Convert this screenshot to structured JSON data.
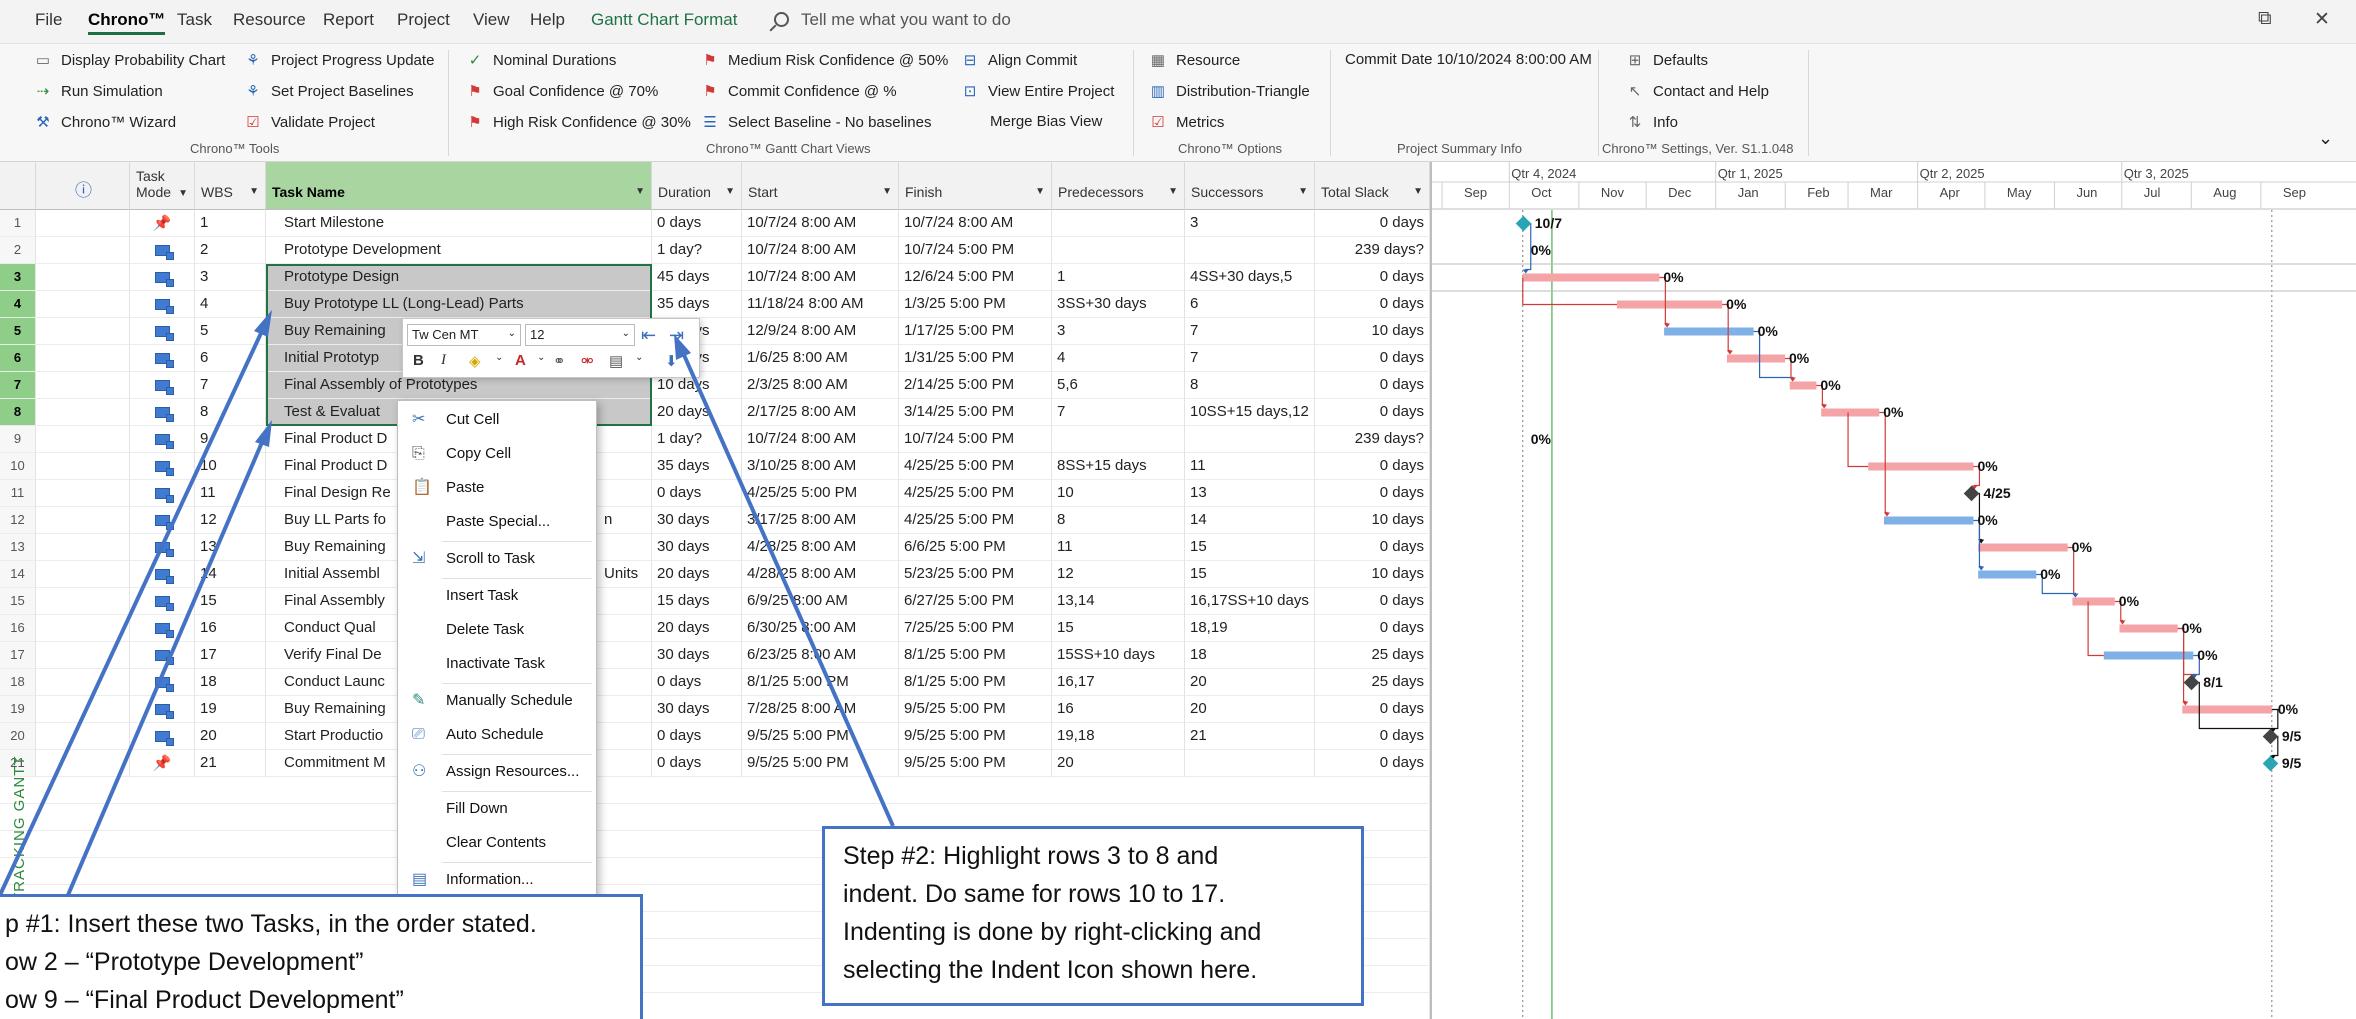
{
  "menu": {
    "items": [
      "File",
      "Chrono™",
      "Task",
      "Resource",
      "Report",
      "Project",
      "View",
      "Help",
      "Gantt Chart Format"
    ],
    "tell_me": "Tell me what you want to do",
    "restore": "⧉",
    "close": "✕"
  },
  "ribbon": {
    "tools": {
      "display_probability_chart": "Display Probability Chart",
      "run_simulation": "Run Simulation",
      "chrono_wizard": "Chrono™ Wizard",
      "project_progress_update": "Project Progress Update",
      "set_project_baselines": "Set Project Baselines",
      "validate_project": "Validate Project",
      "group_label": "Chrono™ Tools"
    },
    "views": {
      "nominal_durations": "Nominal Durations",
      "goal_confidence": "Goal Confidence @ 70%",
      "high_risk_confidence": "High Risk Confidence @ 30%",
      "medium_risk_confidence": "Medium Risk Confidence @ 50%",
      "commit_confidence": "Commit Confidence @ %",
      "select_baseline": "Select Baseline - No baselines",
      "align_commit": "Align Commit",
      "view_entire_project": "View Entire Project",
      "merge_bias_view": "Merge Bias View",
      "group_label": "Chrono™ Gantt Chart Views"
    },
    "options": {
      "resource": "Resource",
      "distribution_triangle": "Distribution-Triangle",
      "metrics": "Metrics",
      "group_label": "Chrono™ Options"
    },
    "summary": {
      "commit_date": "Commit Date 10/10/2024 8:00:00 AM",
      "group_label": "Project Summary Info"
    },
    "settings": {
      "defaults": "Defaults",
      "contact_help": "Contact and Help",
      "info": "Info",
      "group_label": "Chrono™ Settings, Ver. S1.1.048"
    },
    "collapse": "⌄"
  },
  "columns": {
    "info": "ⓘ",
    "task_mode": "Task Mode",
    "wbs": "WBS",
    "task_name": "Task Name",
    "duration": "Duration",
    "start": "Start",
    "finish": "Finish",
    "predecessors": "Predecessors",
    "successors": "Successors",
    "total_slack": "Total Slack"
  },
  "rows": [
    {
      "id": "1",
      "mode": "manual",
      "wbs": "1",
      "name": "Start Milestone",
      "duration": "0 days",
      "start": "10/7/24 8:00 AM",
      "finish": "10/7/24 8:00 AM",
      "pred": "",
      "succ": "3",
      "slack": "0 days",
      "sel": false
    },
    {
      "id": "2",
      "mode": "auto",
      "wbs": "2",
      "name": "Prototype Development",
      "duration": "1 day?",
      "start": "10/7/24 8:00 AM",
      "finish": "10/7/24 5:00 PM",
      "pred": "",
      "succ": "",
      "slack": "239 days?",
      "sel": false
    },
    {
      "id": "3",
      "mode": "auto",
      "wbs": "3",
      "name": "Prototype Design",
      "duration": "45 days",
      "start": "10/7/24 8:00 AM",
      "finish": "12/6/24 5:00 PM",
      "pred": "1",
      "succ": "4SS+30 days,5",
      "slack": "0 days",
      "sel": true
    },
    {
      "id": "4",
      "mode": "auto",
      "wbs": "4",
      "name": "Buy Prototype LL (Long-Lead) Parts",
      "duration": "35 days",
      "start": "11/18/24 8:00 AM",
      "finish": "1/3/25 5:00 PM",
      "pred": "3SS+30 days",
      "succ": "6",
      "slack": "0 days",
      "sel": true
    },
    {
      "id": "5",
      "mode": "auto",
      "wbs": "5",
      "name": "Buy Remaining",
      "duration": "25 days",
      "start": "12/9/24 8:00 AM",
      "finish": "1/17/25 5:00 PM",
      "pred": "3",
      "succ": "7",
      "slack": "10 days",
      "sel": true
    },
    {
      "id": "6",
      "mode": "auto",
      "wbs": "6",
      "name": "Initial Prototyp",
      "duration": "20 days",
      "start": "1/6/25 8:00 AM",
      "finish": "1/31/25 5:00 PM",
      "pred": "4",
      "succ": "7",
      "slack": "0 days",
      "sel": true
    },
    {
      "id": "7",
      "mode": "auto",
      "wbs": "7",
      "name": "Final Assembly of Prototypes",
      "duration": "10 days",
      "start": "2/3/25 8:00 AM",
      "finish": "2/14/25 5:00 PM",
      "pred": "5,6",
      "succ": "8",
      "slack": "0 days",
      "sel": true
    },
    {
      "id": "8",
      "mode": "auto",
      "wbs": "8",
      "name": "Test & Evaluat",
      "duration": "20 days",
      "start": "2/17/25 8:00 AM",
      "finish": "3/14/25 5:00 PM",
      "pred": "7",
      "succ": "10SS+15 days,12",
      "slack": "0 days",
      "sel": true
    },
    {
      "id": "9",
      "mode": "auto",
      "wbs": "9",
      "name": "Final Product D",
      "duration": "1 day?",
      "start": "10/7/24 8:00 AM",
      "finish": "10/7/24 5:00 PM",
      "pred": "",
      "succ": "",
      "slack": "239 days?",
      "sel": false
    },
    {
      "id": "10",
      "mode": "auto",
      "wbs": "10",
      "name": "Final Product D",
      "duration": "35 days",
      "start": "3/10/25 8:00 AM",
      "finish": "4/25/25 5:00 PM",
      "pred": "8SS+15 days",
      "succ": "11",
      "slack": "0 days",
      "sel": false
    },
    {
      "id": "11",
      "mode": "auto",
      "wbs": "11",
      "name": "Final Design Re",
      "duration": "0 days",
      "start": "4/25/25 5:00 PM",
      "finish": "4/25/25 5:00 PM",
      "pred": "10",
      "succ": "13",
      "slack": "0 days",
      "sel": false
    },
    {
      "id": "12",
      "mode": "auto",
      "wbs": "12",
      "name": "Buy LL Parts fo",
      "duration": "30 days",
      "start": "3/17/25 8:00 AM",
      "finish": "4/25/25 5:00 PM",
      "pred": "8",
      "succ": "14",
      "slack": "10 days",
      "sel": false
    },
    {
      "id": "13",
      "mode": "auto",
      "wbs": "13",
      "name": "Buy Remaining",
      "duration": "30 days",
      "start": "4/28/25 8:00 AM",
      "finish": "6/6/25 5:00 PM",
      "pred": "11",
      "succ": "15",
      "slack": "0 days",
      "sel": false
    },
    {
      "id": "14",
      "mode": "auto",
      "wbs": "14",
      "name": "Initial Assembl",
      "duration": "20 days",
      "start": "4/28/25 8:00 AM",
      "finish": "5/23/25 5:00 PM",
      "pred": "12",
      "succ": "15",
      "slack": "10 days",
      "sel": false
    },
    {
      "id": "15",
      "mode": "auto",
      "wbs": "15",
      "name": "Final Assembly",
      "duration": "15 days",
      "start": "6/9/25 8:00 AM",
      "finish": "6/27/25 5:00 PM",
      "pred": "13,14",
      "succ": "16,17SS+10 days",
      "slack": "0 days",
      "sel": false
    },
    {
      "id": "16",
      "mode": "auto",
      "wbs": "16",
      "name": "Conduct Qual",
      "duration": "20 days",
      "start": "6/30/25 8:00 AM",
      "finish": "7/25/25 5:00 PM",
      "pred": "15",
      "succ": "18,19",
      "slack": "0 days",
      "sel": false
    },
    {
      "id": "17",
      "mode": "auto",
      "wbs": "17",
      "name": "Verify Final De",
      "duration": "30 days",
      "start": "6/23/25 8:00 AM",
      "finish": "8/1/25 5:00 PM",
      "pred": "15SS+10 days",
      "succ": "18",
      "slack": "25 days",
      "sel": false
    },
    {
      "id": "18",
      "mode": "auto",
      "wbs": "18",
      "name": "Conduct Launc",
      "duration": "0 days",
      "start": "8/1/25 5:00 PM",
      "finish": "8/1/25 5:00 PM",
      "pred": "16,17",
      "succ": "20",
      "slack": "25 days",
      "sel": false
    },
    {
      "id": "19",
      "mode": "auto",
      "wbs": "19",
      "name": "Buy Remaining",
      "duration": "30 days",
      "start": "7/28/25 8:00 AM",
      "finish": "9/5/25 5:00 PM",
      "pred": "16",
      "succ": "20",
      "slack": "0 days",
      "sel": false
    },
    {
      "id": "20",
      "mode": "auto",
      "wbs": "20",
      "name": "Start Productio",
      "duration": "0 days",
      "start": "9/5/25 5:00 PM",
      "finish": "9/5/25 5:00 PM",
      "pred": "19,18",
      "succ": "21",
      "slack": "0 days",
      "sel": false
    },
    {
      "id": "21",
      "mode": "manual",
      "wbs": "21",
      "name": "Commitment M",
      "duration": "0 days",
      "start": "9/5/25 5:00 PM",
      "finish": "9/5/25 5:00 PM",
      "pred": "20",
      "succ": "",
      "slack": "0 days",
      "sel": false
    }
  ],
  "row14_name_tail": "Units",
  "row12_name_tail": "n",
  "side_label": "TRACKING GANTT",
  "timeline": {
    "quarters": [
      "Qtr 4, 2024",
      "Qtr 1, 2025",
      "Qtr 2, 2025",
      "Qtr 3, 2025"
    ],
    "months": [
      "Sep",
      "Oct",
      "Nov",
      "Dec",
      "Jan",
      "Feb",
      "Mar",
      "Apr",
      "May",
      "Jun",
      "Jul",
      "Aug",
      "Sep"
    ]
  },
  "gantt_labels": {
    "r1": "10/7",
    "r2": "0%",
    "r3": "0%",
    "r4": "0%",
    "r5": "0%",
    "r6": "0%",
    "r7": "0%",
    "r8": "0%",
    "r9": "0%",
    "r10": "0%",
    "r11": "4/25",
    "r12": "0%",
    "r13": "0%",
    "r14": "0%",
    "r15": "0%",
    "r16": "0%",
    "r17": "0%",
    "r18": "8/1",
    "r19": "0%",
    "r20": "9/5",
    "r21": "9/5"
  },
  "mini_toolbar": {
    "font": "Tw Cen MT",
    "size": "12",
    "bold": "B",
    "italic": "I"
  },
  "context_menu": [
    "Cut Cell",
    "Copy Cell",
    "Paste",
    "Paste Special...",
    "Scroll to Task",
    "Insert Task",
    "Delete Task",
    "Inactivate Task",
    "Manually Schedule",
    "Auto Schedule",
    "Assign Resources...",
    "Fill Down",
    "Clear Contents",
    "Information..."
  ],
  "callouts": {
    "step1": [
      "p #1: Insert these two Tasks, in the order stated.",
      "ow 2 – “Prototype Development”",
      "ow 9 – “Final Product Development”"
    ],
    "step2": [
      "Step #2: Highlight rows 3 to 8 and",
      "indent.  Do same for rows 10 to 17.",
      "Indenting is done by right-clicking and",
      "selecting the Indent Icon shown here."
    ]
  },
  "colors": {
    "critical_bar": "#f4a3a7",
    "normal_bar": "#7fb0e6",
    "callout_border": "#4472c4",
    "selected_row_header": "#8fce89",
    "task_name_header": "#a8d5a0"
  }
}
